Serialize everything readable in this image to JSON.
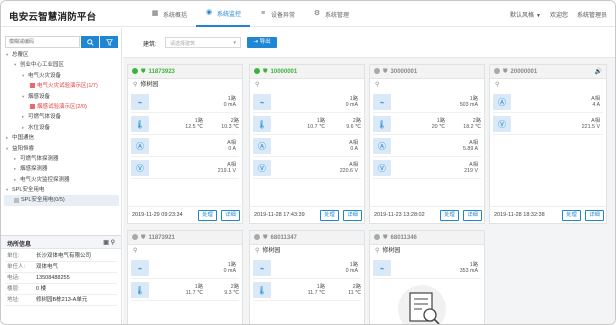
{
  "app": {
    "title": "电安云智慧消防平台"
  },
  "nav": {
    "tabs": [
      {
        "label": "系统概括",
        "icon": "calendar-icon"
      },
      {
        "label": "系统监控",
        "icon": "eye-icon"
      },
      {
        "label": "设备异常",
        "icon": "sliders-icon"
      },
      {
        "label": "系统管理",
        "icon": "gear-icon"
      }
    ]
  },
  "header_right": {
    "style": "默认风格",
    "welcome": "欢迎您",
    "user": "系统管理员"
  },
  "sidebar": {
    "search_placeholder": "模糊减编码",
    "tree": [
      "总覆区",
      "创业中心工业园区",
      "电气火灾设备",
      "电气火灾试验演示区(1/7)",
      "烟感设备",
      "烟感试验演示区(2/0)",
      "可燃气体设备",
      "水位设备",
      "中国通信",
      "益阳恒睿",
      "可燃气体探测器",
      "烟感探测器",
      "电气火灾监控探测器",
      "SPL安全用电",
      "SPL安全用电(0/5)"
    ]
  },
  "info": {
    "title": "场所信息",
    "rows": [
      {
        "k": "单位:",
        "v": "长沙双体电气有限公司"
      },
      {
        "k": "单任人:",
        "v": "双体电气"
      },
      {
        "k": "电话:",
        "v": "13508488255"
      },
      {
        "k": "楼层:",
        "v": "0 楼"
      },
      {
        "k": "地址:",
        "v": "修树园B栋213-A单元"
      }
    ]
  },
  "toolbar": {
    "building_label": "建筑:",
    "select_placeholder": "请选择建筑",
    "export_label": "导出"
  },
  "cards": [
    {
      "code": "11873923",
      "status": "green",
      "location": "修树园",
      "r1": [
        "1路",
        "0 mA"
      ],
      "r2a": [
        "1路",
        "12.5 ℃"
      ],
      "r2b": [
        "2路",
        "10.3 ℃"
      ],
      "r3": [
        "A相",
        "0 A"
      ],
      "r4": [
        "A相",
        "219.1 V"
      ],
      "time": "2019-11-29 09:23:34",
      "btn1": "处理",
      "btn2": "详细"
    },
    {
      "code": "10000001",
      "status": "green",
      "location": "",
      "r1": [
        "1路",
        "0 mA"
      ],
      "r2a": [
        "1路",
        "10.7 ℃"
      ],
      "r2b": [
        "2路",
        "9.6 ℃"
      ],
      "r3": [
        "A相",
        "0 A"
      ],
      "r4": [
        "A相",
        "220.6 V"
      ],
      "time": "2019-11-28 17:43:39",
      "btn1": "处理",
      "btn2": "详细"
    },
    {
      "code": "30000001",
      "status": "gray",
      "location": "",
      "r1": [
        "1路",
        "503 mA"
      ],
      "r2a": [
        "1路",
        "20 ℃"
      ],
      "r2b": [
        "2路",
        "18.2 ℃"
      ],
      "r3": [
        "A相",
        "5.89 A"
      ],
      "r4": [
        "A相",
        "219 V"
      ],
      "time": "2019-11-23 13:28:02",
      "btn1": "处理",
      "btn2": "详细"
    },
    {
      "code": "20000001",
      "status": "gray",
      "location": "",
      "r3": [
        "A相",
        "4 A"
      ],
      "r4": [
        "A相",
        "221.5 V"
      ],
      "time": "2019-11-28 18:32:38",
      "btn1": "处理",
      "btn2": "详细"
    },
    {
      "code": "11873921",
      "status": "gray",
      "location": "",
      "r1": [
        "1路",
        "0 mA"
      ],
      "r2a": [
        "1路",
        "11.7 ℃"
      ],
      "r2b": [
        "2路",
        "9.3 ℃"
      ]
    },
    {
      "code": "68011347",
      "status": "gray",
      "location": "修树园",
      "r1": [
        "1路",
        "0 mA"
      ],
      "r2a": [
        "1路",
        "11.7 ℃"
      ],
      "r2b": [
        "2路",
        "11 ℃"
      ]
    },
    {
      "code": "68011346",
      "status": "gray",
      "location": "修树园"
    },
    {
      "code": "",
      "status": "none",
      "location": ""
    }
  ],
  "card5_r1b": [
    "1路",
    "353 mA"
  ]
}
